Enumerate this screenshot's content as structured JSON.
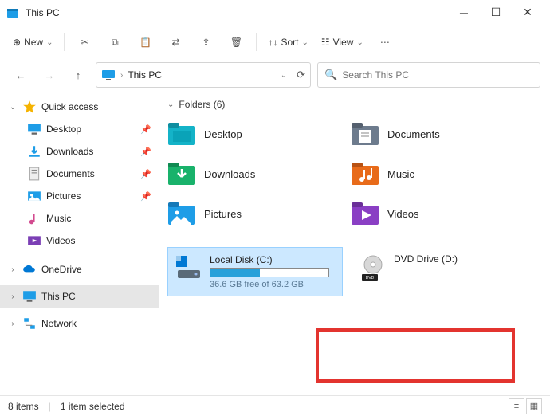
{
  "window": {
    "title": "This PC"
  },
  "toolbar": {
    "new": "New",
    "sort": "Sort",
    "view": "View"
  },
  "address": {
    "location": "This PC"
  },
  "search": {
    "placeholder": "Search This PC"
  },
  "sidebar": {
    "quickaccess": "Quick access",
    "desktop": "Desktop",
    "downloads": "Downloads",
    "documents": "Documents",
    "pictures": "Pictures",
    "music": "Music",
    "videos": "Videos",
    "onedrive": "OneDrive",
    "thispc": "This PC",
    "network": "Network"
  },
  "groups": {
    "folders": "Folders (6)"
  },
  "folders": {
    "desktop": "Desktop",
    "documents": "Documents",
    "downloads": "Downloads",
    "music": "Music",
    "pictures": "Pictures",
    "videos": "Videos"
  },
  "drives": {
    "c": {
      "name": "Local Disk (C:)",
      "status": "36.6 GB free of 63.2 GB",
      "used_pct": 42
    },
    "d": {
      "name": "DVD Drive (D:)"
    }
  },
  "status": {
    "items": "8 items",
    "selected": "1 item selected"
  }
}
